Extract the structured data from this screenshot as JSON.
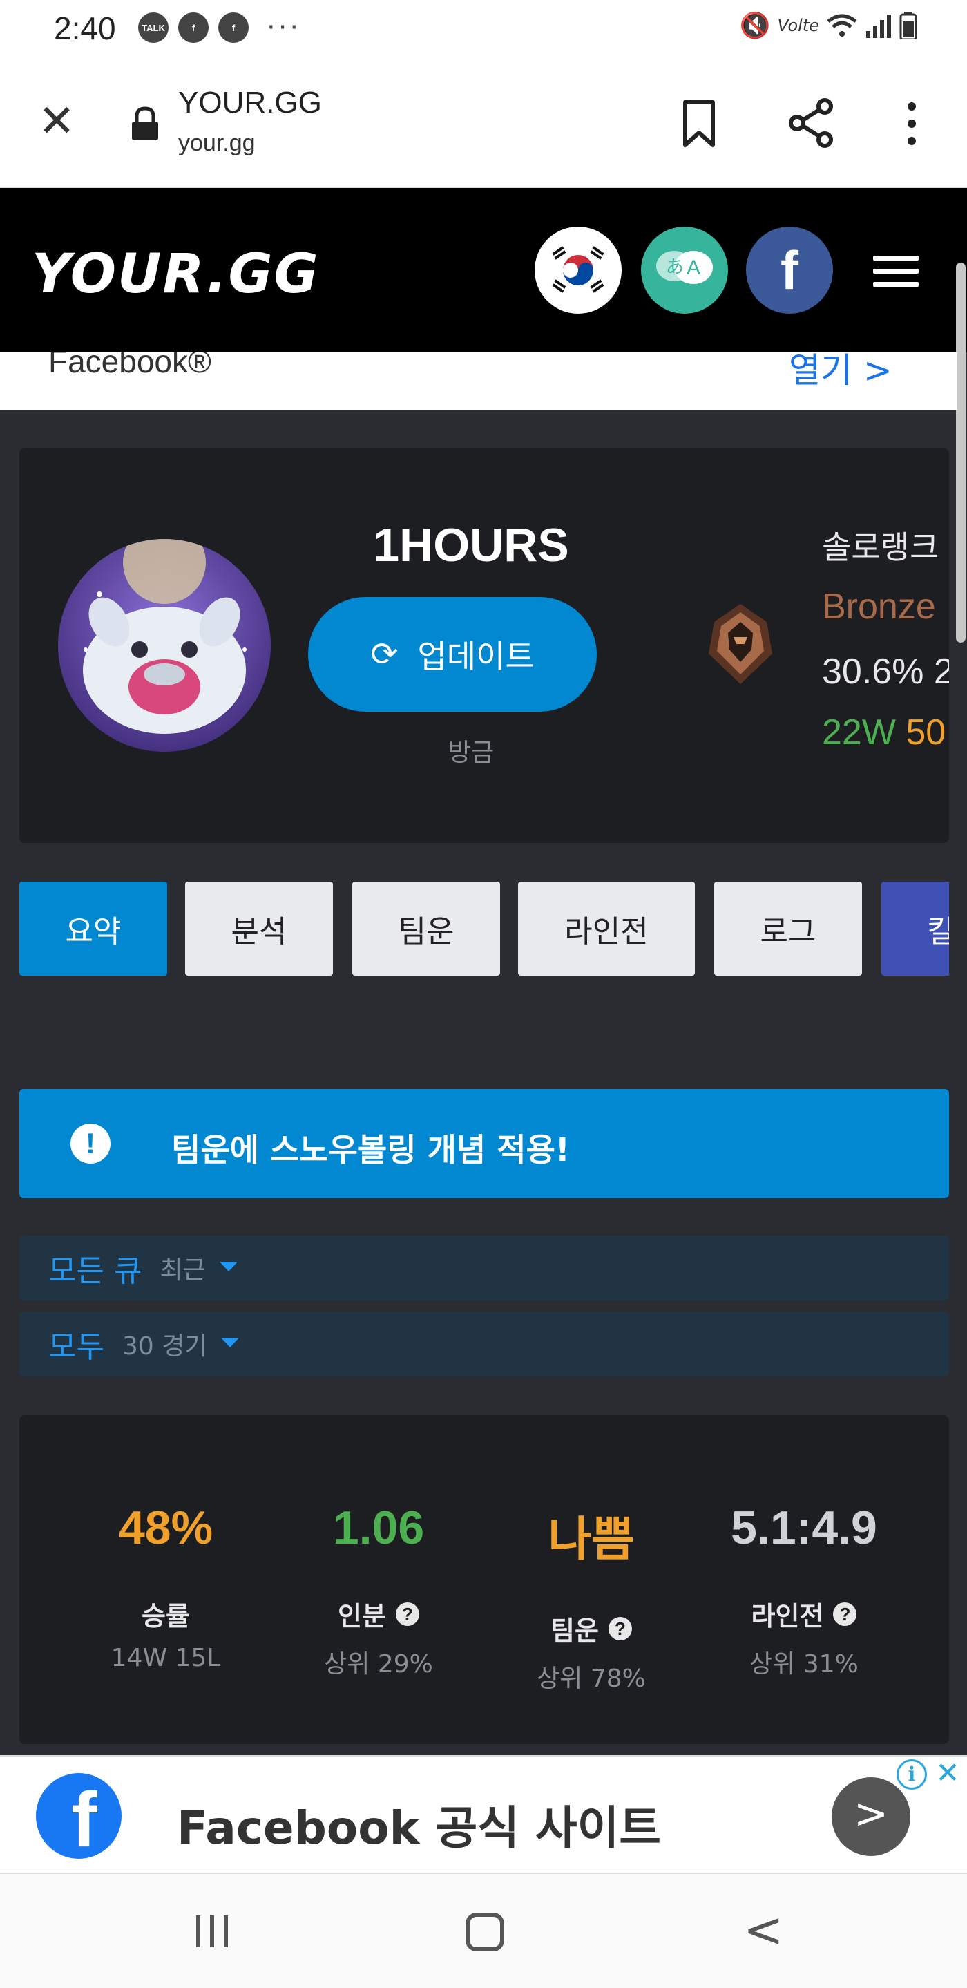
{
  "status_bar": {
    "time": "2:40",
    "left_icons": [
      "talk-icon",
      "facebook-icon",
      "facebook-icon"
    ],
    "more": "···",
    "network_label": "Volte"
  },
  "browser": {
    "title": "YOUR.GG",
    "url": "your.gg"
  },
  "header": {
    "logo": "YOUR.GG",
    "translate_left": "あ",
    "translate_right": "A",
    "facebook": "f"
  },
  "peek_row": {
    "text": "Facebook®",
    "link": "열기 >"
  },
  "profile": {
    "summoner_name": "1HOURS",
    "update_label": "업데이트",
    "updated_time": "방금",
    "queue_label": "솔로랭크",
    "tier": "Bronze",
    "winrate": "30.6% 2",
    "wins": "22W",
    "losses": "50"
  },
  "tabs": [
    {
      "label": "요약",
      "active": true
    },
    {
      "label": "분석",
      "active": false
    },
    {
      "label": "팀운",
      "active": false
    },
    {
      "label": "라인전",
      "active": false
    },
    {
      "label": "로그",
      "active": false
    },
    {
      "label": "킬",
      "active": false
    }
  ],
  "notice": {
    "icon": "!",
    "text": "팀운에 스노우볼링 개념 적용!"
  },
  "filters": {
    "queue_main": "모든 큐",
    "queue_sub": "최근",
    "games_main": "모두",
    "games_sub": "30 경기"
  },
  "stats": [
    {
      "value": "48%",
      "label": "승률",
      "sub": "14W 15L",
      "color": "#f0a12b",
      "help": false
    },
    {
      "value": "1.06",
      "label": "인분",
      "sub": "상위 29%",
      "color": "#4caf50",
      "help": true
    },
    {
      "value": "나쁨",
      "label": "팀운",
      "sub": "상위 78%",
      "color": "#f0a12b",
      "help": true
    },
    {
      "value": "5.1:4.9",
      "label": "라인전",
      "sub": "상위 31%",
      "color": "#cfd2d6",
      "help": true
    }
  ],
  "ad": {
    "text": "Facebook 공식 사이트",
    "logo": "f",
    "arrow": ">",
    "info": "i",
    "close": "✕"
  },
  "nav": {
    "back": "<"
  },
  "colors": {
    "accent": "#0288d1",
    "bronze": "#a86b4a",
    "win": "#4caf50",
    "loss": "#f0a12b",
    "card": "#1d1e22",
    "page_bg": "#2a2c31"
  }
}
